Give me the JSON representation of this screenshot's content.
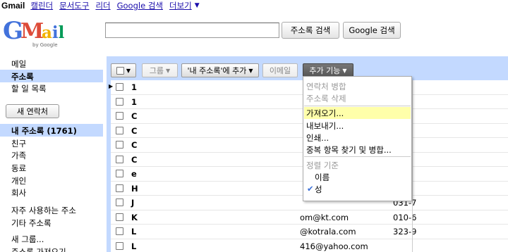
{
  "topnav": {
    "current": "Gmail",
    "links": [
      "캘린더",
      "문서도구",
      "리더",
      "Google 검색",
      "더보기"
    ],
    "more_arrow": "▼"
  },
  "logo": {
    "g": "G",
    "m": "M",
    "a": "a",
    "i": "i",
    "l": "l",
    "by": "by Google"
  },
  "search": {
    "value": "",
    "contacts_button": "주소록 검색",
    "google_button": "Google 검색"
  },
  "sidebar": {
    "mail": "메일",
    "contacts": "주소록",
    "tasks": "할 일 목록",
    "new_contact": "새 연락처",
    "my_contacts": "내 주소록 (1761)",
    "groups": [
      "친구",
      "가족",
      "동료",
      "개인",
      "회사"
    ],
    "frequent": "자주 사용하는 주소",
    "other": "기타 주소록",
    "new_group": "새 그룹...",
    "import": "주소록 가져오기"
  },
  "toolbar": {
    "group": "그룹",
    "add_to_my_contacts": "'내 주소록'에 추가",
    "email": "이메일",
    "more_actions": "추가 기능"
  },
  "menu": {
    "merge": "연락처 병합",
    "delete": "주소록 삭제",
    "import": "가져오기...",
    "export": "내보내기...",
    "print": "인쇄...",
    "find_duplicates": "중복 항목 찾기 및 병합...",
    "sort_header": "정렬 기준",
    "sort_name": "이름",
    "sort_last": "성",
    "check": "✔"
  },
  "rows": [
    {
      "name": "1",
      "email": "",
      "phone": ""
    },
    {
      "name": "1",
      "email": "",
      "phone": ""
    },
    {
      "name": "C",
      "email": "",
      "phone": ""
    },
    {
      "name": "C",
      "email": "",
      "phone": ""
    },
    {
      "name": "C",
      "email": "",
      "phone": ""
    },
    {
      "name": "C",
      "email": "",
      "phone": ""
    },
    {
      "name": "e",
      "email": "",
      "phone": ""
    },
    {
      "name": "H",
      "email": "",
      "phone": ""
    },
    {
      "name": "J",
      "email": "",
      "phone": "031-7"
    },
    {
      "name": "K",
      "email": "om@kt.com",
      "phone": "010-6"
    },
    {
      "name": "L",
      "email": "@kotrala.com",
      "phone": "323-9"
    },
    {
      "name": "L",
      "email": "416@yahoo.com",
      "phone": ""
    }
  ]
}
